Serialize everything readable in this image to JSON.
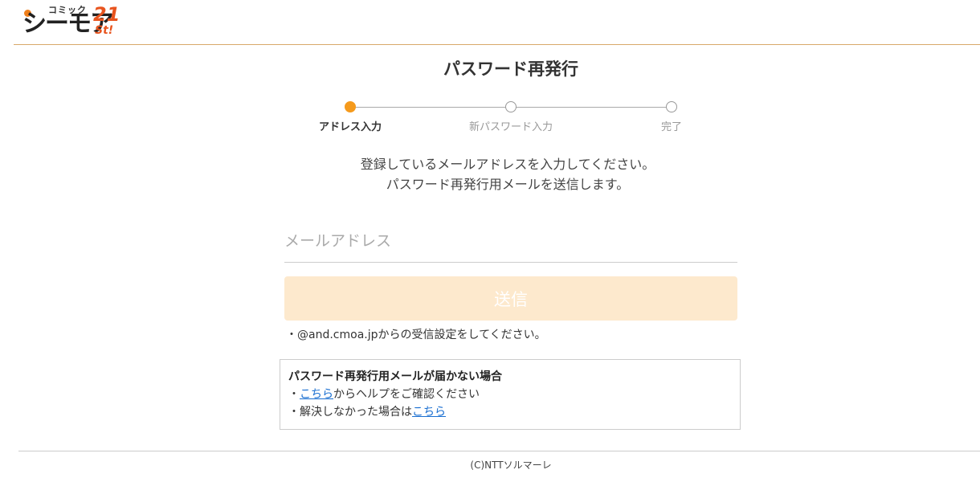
{
  "brand": {
    "logo_small": "コミック",
    "logo_main": "シーモア",
    "logo_num": "21",
    "logo_sub": "St!"
  },
  "page": {
    "title": "パスワード再発行"
  },
  "steps": [
    {
      "label": "アドレス入力",
      "active": true
    },
    {
      "label": "新パスワード入力",
      "active": false
    },
    {
      "label": "完了",
      "active": false
    }
  ],
  "description": {
    "line1": "登録しているメールアドレスを入力してください。",
    "line2": "パスワード再発行用メールを送信します。"
  },
  "form": {
    "email_placeholder": "メールアドレス",
    "email_value": "",
    "submit_label": "送信",
    "note": "・@and.cmoa.jpからの受信設定をしてください。"
  },
  "help": {
    "title": "パスワード再発行用メールが届かない場合",
    "item1_prefix": "・",
    "item1_link": "こちら",
    "item1_suffix": "からヘルプをご確認ください",
    "item2_prefix": "・解決しなかった場合は",
    "item2_link": "こちら"
  },
  "footer": {
    "copyright": "(C)NTTソルマーレ"
  },
  "colors": {
    "accent": "#f59a1c",
    "button_bg": "#fde9cd",
    "link": "#1a6fd1"
  }
}
